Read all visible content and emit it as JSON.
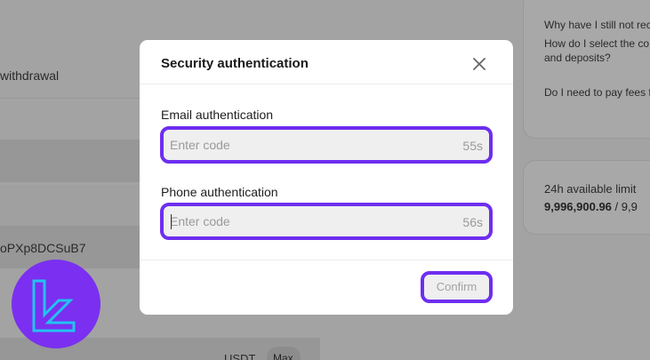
{
  "background": {
    "withdrawal_fragment": "withdrawal",
    "address_fragment": "oPXp8DCSuB7",
    "currency": "USDT",
    "max_label": "Max",
    "faq": {
      "items": [
        "Why have I still not rec",
        "How do I select the co\nand deposits?",
        "Do I need to pay fees f"
      ]
    },
    "limit": {
      "label": "24h available limit",
      "value_bold": "9,996,900.96",
      "value_rest": " / 9,9"
    }
  },
  "logo": {
    "icon": "brand-logo-icon",
    "bg_color": "#7b2ff0",
    "stroke_color": "#22c3f0"
  },
  "modal": {
    "title": "Security authentication",
    "close_icon": "close-icon",
    "email": {
      "label": "Email authentication",
      "placeholder": "Enter code",
      "value": "",
      "timer": "55s"
    },
    "phone": {
      "label": "Phone authentication",
      "placeholder": "Enter code",
      "value": "",
      "timer": "56s"
    },
    "confirm_label": "Confirm",
    "accent_color": "#6e2ef0"
  }
}
